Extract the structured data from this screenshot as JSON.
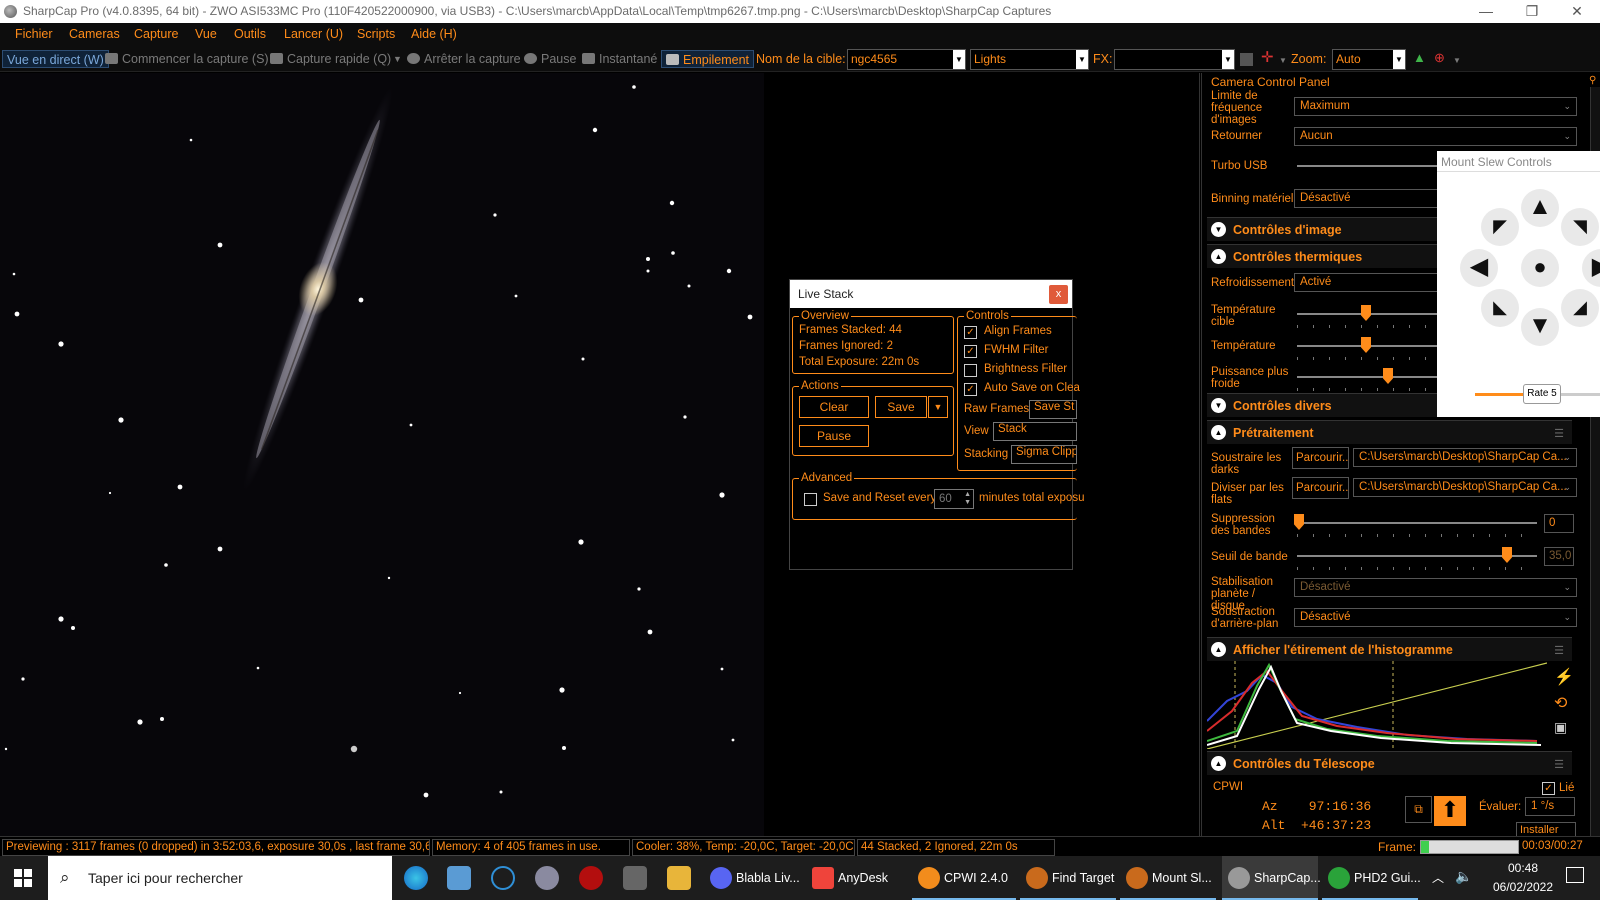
{
  "window": {
    "title": "SharpCap Pro (v4.0.8395, 64 bit) - ZWO ASI533MC Pro (110F420522000900, via USB3) - C:\\Users\\marcb\\AppData\\Local\\Temp\\tmp6267.tmp.png - C:\\Users\\marcb\\Desktop\\SharpCap Captures",
    "minimize": "—",
    "maximize": "❐",
    "close": "✕"
  },
  "menu": [
    "Fichier",
    "Cameras",
    "Capture",
    "Vue",
    "Outils",
    "Lancer (U)",
    "Scripts",
    "Aide (H)"
  ],
  "toolbar": {
    "live_view": "Vue en direct (W)",
    "start_capture": "Commencer la capture (S)",
    "quick_capture": "Capture rapide (Q)",
    "stop_capture": "Arrêter la capture",
    "pause": "Pause",
    "snapshot": "Instantané",
    "stacking": "Empilement",
    "target_label": "Nom de la cible:",
    "target_value": "ngc4565",
    "frame_type": "Lights",
    "fx_label": "FX:",
    "fx_value": "",
    "zoom_label": "Zoom:",
    "zoom_value": "Auto"
  },
  "live_stack": {
    "title": "Live Stack",
    "close": "x",
    "overview_label": "Overview",
    "frames_stacked": "Frames Stacked:  44",
    "frames_ignored": "Frames Ignored:  2",
    "total_exposure": "Total Exposure:   22m 0s",
    "controls_label": "Controls",
    "align_frames": "Align Frames",
    "fwhm_filter": "FWHM Filter",
    "brightness_filter": "Brightness Filter",
    "auto_save": "Auto Save on Clea",
    "raw_frames_label": "Raw Frames",
    "raw_frames_value": "Save St",
    "view_label": "View",
    "view_value": "Stack",
    "stacking_label": "Stacking",
    "stacking_value": "Sigma Clipp",
    "actions_label": "Actions",
    "clear": "Clear",
    "save": "Save",
    "pause": "Pause",
    "advanced_label": "Advanced",
    "save_reset": "Save and Reset every",
    "save_reset_value": "60",
    "save_reset_suffix": "minutes total exposu",
    "checks": {
      "align": true,
      "fwhm": true,
      "brightness": false,
      "autosave": true,
      "save_reset": false
    }
  },
  "panel": {
    "title": "Camera Control Panel",
    "frame_rate_label": "Limite de fréquence d'images",
    "frame_rate_value": "Maximum",
    "flip_label": "Retourner",
    "flip_value": "Aucun",
    "turbo_label": "Turbo USB",
    "binning_label": "Binning matériel",
    "binning_value": "Désactivé",
    "image_controls": "Contrôles d'image",
    "thermal_controls": "Contrôles thermiques",
    "cooling_label": "Refroidissement",
    "cooling_value": "Activé",
    "target_temp_label": "Température cible",
    "temp_label": "Température",
    "cooler_power_label": "Puissance plus froide",
    "misc_controls": "Contrôles divers",
    "preprocessing": "Prétraitement",
    "darks_label": "Soustraire les darks",
    "flats_label": "Diviser par les flats",
    "browse": "Parcourir...",
    "darks_path": "C:\\Users\\marcb\\Desktop\\SharpCap Ca...",
    "flats_path": "C:\\Users\\marcb\\Desktop\\SharpCap Ca...",
    "banding_label": "Suppression des bandes",
    "banding_value": "0",
    "band_threshold_label": "Seuil de bande",
    "band_threshold_value": "35,0",
    "stabilization_label": "Stabilisation planète / disque",
    "stabilization_value": "Désactivé",
    "bg_sub_label": "Soustraction d'arrière-plan",
    "bg_sub_value": "Désactivé",
    "histogram": "Afficher l'étirement de l'histogramme",
    "telescope": "Contrôles du Télescope",
    "mount_name": "CPWI",
    "linked": "Lié",
    "az": "Az    97:16:36",
    "alt": "Alt  +46:37:23",
    "rate_label": "Évaluer:",
    "rate_value": "1 °/s",
    "install": "Installer"
  },
  "mount_slew": {
    "title": "Mount Slew Controls",
    "rate": "Rate 5"
  },
  "status": {
    "preview": "Previewing : 3117 frames (0 dropped) in 3:52:03,6, exposure 30,0s , last frame 30,6",
    "memory": "Memory: 4 of 405 frames in use.",
    "cooler": "Cooler: 38%, Temp: -20,0C, Target: -20,0C",
    "stacked": "44 Stacked, 2 Ignored, 22m 0s",
    "frame_label": "Frame:",
    "frame_time": "00:03/00:27",
    "frame_progress": 0.08
  },
  "taskbar": {
    "search": "Taper ici pour rechercher",
    "apps": [
      "Blabla Liv...",
      "AnyDesk",
      "CPWI 2.4.0",
      "Find Target",
      "Mount Sl...",
      "SharpCap...",
      "PHD2 Gui..."
    ],
    "time": "00:48",
    "date": "06/02/2022"
  },
  "colors": {
    "accent": "#ff8c1a",
    "background": "#000000",
    "taskbar": "#1d1d1d"
  }
}
